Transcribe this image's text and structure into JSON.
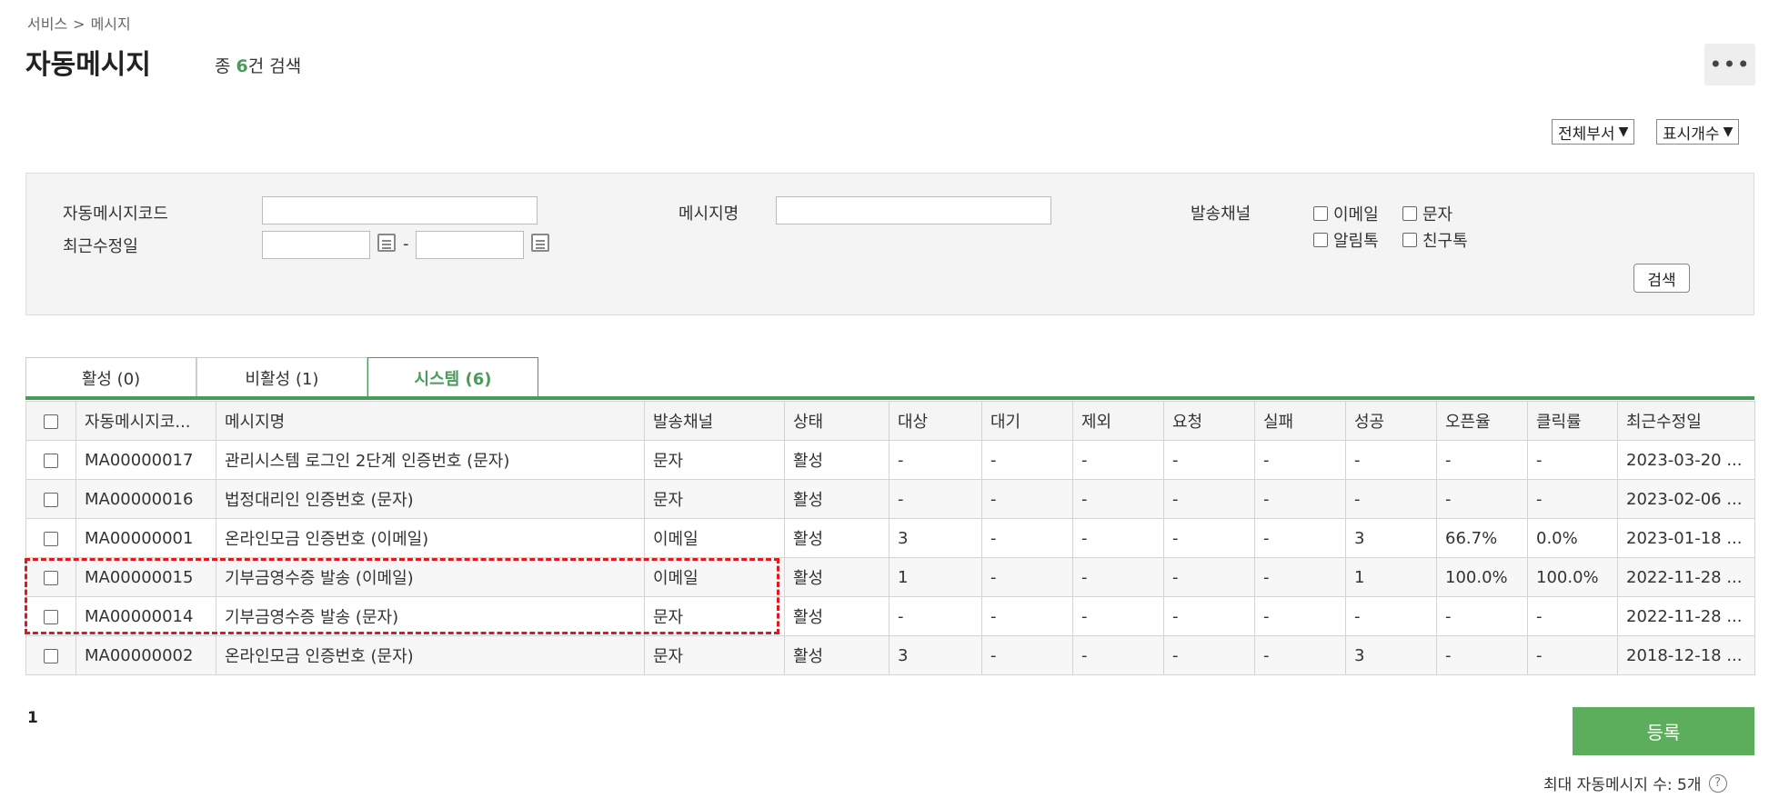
{
  "breadcrumb": [
    "서비스",
    ">",
    "메시지"
  ],
  "page_title": "자동메시지",
  "count": {
    "prefix": "종",
    "num": "6",
    "suffix": "건 검색"
  },
  "more_icon": "more-horizontal-icon",
  "top_selects": {
    "dept": "전체부서",
    "display_count": "표시개수"
  },
  "search": {
    "code_label": "자동메시지코드",
    "code_value": "",
    "name_label": "메시지명",
    "name_value": "",
    "channel_label": "발송채널",
    "date_label": "최근수정일",
    "date_sep": "-",
    "date_from": "",
    "date_to": "",
    "channels": [
      "이메일",
      "문자",
      "알림톡",
      "친구톡"
    ],
    "button": "검색"
  },
  "tabs": [
    "활성 (0)",
    "비활성 (1)",
    "시스템 (6)"
  ],
  "active_tab": 2,
  "table": {
    "columns": [
      "자동메시지코...",
      "메시지명",
      "발송채널",
      "상태",
      "대상",
      "대기",
      "제외",
      "요청",
      "실패",
      "성공",
      "오픈율",
      "클릭률",
      "최근수정일"
    ],
    "rows": [
      [
        "MA00000017",
        "관리시스템 로그인 2단계 인증번호 (문자)",
        "문자",
        "활성",
        "-",
        "-",
        "-",
        "-",
        "-",
        "-",
        "-",
        "-",
        "2023-03-20 ..."
      ],
      [
        "MA00000016",
        "법정대리인 인증번호 (문자)",
        "문자",
        "활성",
        "-",
        "-",
        "-",
        "-",
        "-",
        "-",
        "-",
        "-",
        "2023-02-06 ..."
      ],
      [
        "MA00000001",
        "온라인모금 인증번호 (이메일)",
        "이메일",
        "활성",
        "3",
        "-",
        "-",
        "-",
        "-",
        "3",
        "66.7%",
        "0.0%",
        "2023-01-18 ..."
      ],
      [
        "MA00000015",
        "기부금영수증 발송 (이메일)",
        "이메일",
        "활성",
        "1",
        "-",
        "-",
        "-",
        "-",
        "1",
        "100.0%",
        "100.0%",
        "2022-11-28 ..."
      ],
      [
        "MA00000014",
        "기부금영수증 발송 (문자)",
        "문자",
        "활성",
        "-",
        "-",
        "-",
        "-",
        "-",
        "-",
        "-",
        "-",
        "2022-11-28 ..."
      ],
      [
        "MA00000002",
        "온라인모금 인증번호 (문자)",
        "문자",
        "활성",
        "3",
        "-",
        "-",
        "-",
        "-",
        "3",
        "-",
        "-",
        "2018-12-18 ..."
      ]
    ]
  },
  "pager": "1",
  "register_button": "등록",
  "max_text": "최대 자동메시지 수: 5개",
  "help_glyph": "?",
  "colors": {
    "accent": "#4a9a5b",
    "register": "#5cae5c",
    "highlight": "#e0191e"
  }
}
